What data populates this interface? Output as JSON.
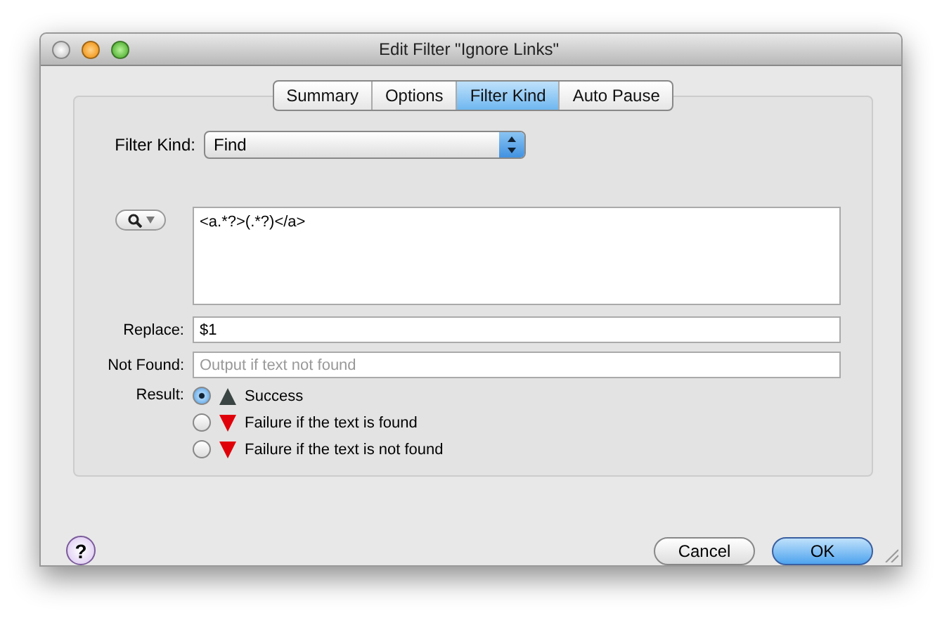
{
  "window": {
    "title": "Edit Filter \"Ignore Links\""
  },
  "tabs": [
    {
      "label": "Summary",
      "selected": false
    },
    {
      "label": "Options",
      "selected": false
    },
    {
      "label": "Filter Kind",
      "selected": true
    },
    {
      "label": "Auto Pause",
      "selected": false
    }
  ],
  "filter_kind": {
    "label": "Filter Kind:",
    "value": "Find"
  },
  "find": {
    "value": "<a.*?>(.*?)</a>"
  },
  "replace": {
    "label": "Replace:",
    "value": "$1"
  },
  "not_found": {
    "label": "Not Found:",
    "placeholder": "Output if text not found"
  },
  "result": {
    "label": "Result:",
    "options": [
      {
        "label": "Success",
        "kind": "success",
        "selected": true
      },
      {
        "label": "Failure if the text is found",
        "kind": "failure",
        "selected": false
      },
      {
        "label": "Failure if the text is not found",
        "kind": "failure",
        "selected": false
      }
    ]
  },
  "help": {
    "label": "?"
  },
  "buttons": [
    {
      "label": "Cancel",
      "kind": "normal"
    },
    {
      "label": "OK",
      "kind": "default"
    }
  ]
}
